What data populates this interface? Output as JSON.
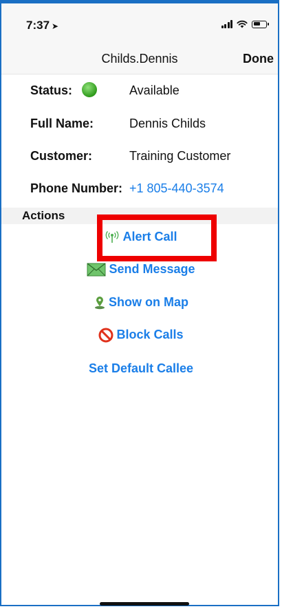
{
  "status_bar": {
    "time": "7:37",
    "location_glyph": "➤"
  },
  "nav": {
    "title": "Childs.Dennis",
    "done_label": "Done"
  },
  "details": {
    "status_label": "Status:",
    "status_value": "Available",
    "status_color": "#2e9a1a",
    "full_name_label": "Full Name:",
    "full_name_value": "Dennis Childs",
    "customer_label": "Customer:",
    "customer_value": "Training Customer",
    "phone_label": "Phone Number:",
    "phone_value": "+1 805-440-3574"
  },
  "actions": {
    "header": "Actions",
    "items": [
      {
        "label": "Alert Call",
        "icon": "broadcast-icon"
      },
      {
        "label": "Send Message",
        "icon": "envelope-icon"
      },
      {
        "label": "Show on Map",
        "icon": "map-pin-icon"
      },
      {
        "label": "Block Calls",
        "icon": "block-icon"
      },
      {
        "label": "Set Default Callee",
        "icon": ""
      }
    ]
  },
  "accent_color": "#1a7ee8",
  "highlight_color": "#ee0000"
}
